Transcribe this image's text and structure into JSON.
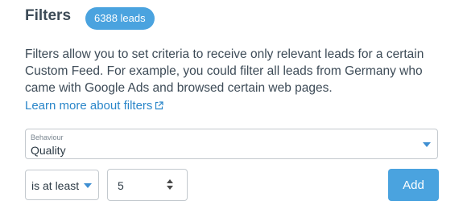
{
  "header": {
    "title": "Filters",
    "leads_badge": "6388 leads"
  },
  "description": "Filters allow you to set criteria to receive only relevant leads for a certain Custom Feed. For example, you could filter all leads from Germany who came with Google Ads and browsed certain web pages.",
  "learn_more_link": "Learn more about filters",
  "behaviour_select": {
    "label": "Behaviour",
    "value": "Quality"
  },
  "operator_select": {
    "value": "is at least"
  },
  "number_input": {
    "value": "5"
  },
  "add_button": "Add",
  "colors": {
    "accent": "#4aa3df",
    "link": "#2a86c9",
    "text": "#3d4b57"
  }
}
